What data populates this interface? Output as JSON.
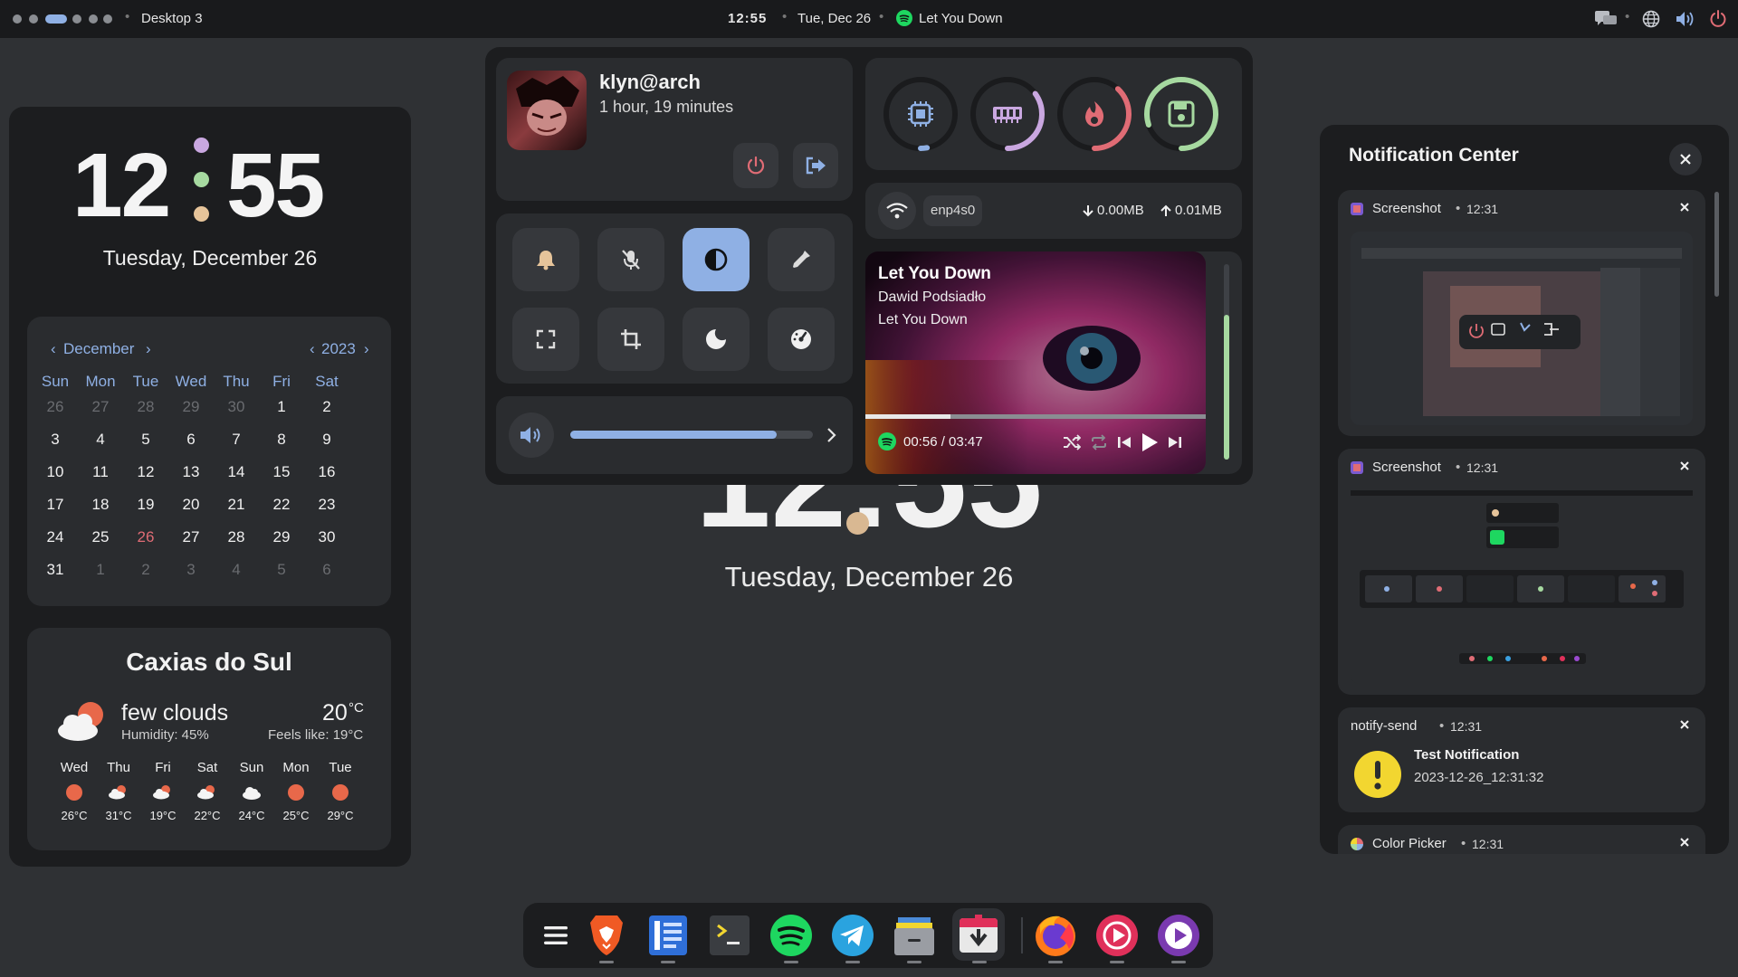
{
  "topbar": {
    "workspace": "Desktop 3",
    "time": "12:55",
    "date": "Tue, Dec 26",
    "now_playing": "Let You Down"
  },
  "background": {
    "time": "12:55",
    "date": "Tuesday, December 26"
  },
  "clock_widget": {
    "hours": "12",
    "minutes": "55",
    "date": "Tuesday, December 26",
    "dot_colors": [
      "#c9a7e0",
      "#a6d9a0",
      "#e6c49a"
    ]
  },
  "calendar": {
    "month": "December",
    "year": "2023",
    "weekdays": [
      "Sun",
      "Mon",
      "Tue",
      "Wed",
      "Thu",
      "Fri",
      "Sat"
    ],
    "weeks": [
      [
        "26",
        "27",
        "28",
        "29",
        "30",
        "1",
        "2"
      ],
      [
        "3",
        "4",
        "5",
        "6",
        "7",
        "8",
        "9"
      ],
      [
        "10",
        "11",
        "12",
        "13",
        "14",
        "15",
        "16"
      ],
      [
        "17",
        "18",
        "19",
        "20",
        "21",
        "22",
        "23"
      ],
      [
        "24",
        "25",
        "26",
        "27",
        "28",
        "29",
        "30"
      ],
      [
        "31",
        "1",
        "2",
        "3",
        "4",
        "5",
        "6"
      ]
    ],
    "today": "26"
  },
  "weather": {
    "city": "Caxias do Sul",
    "condition": "few clouds",
    "humidity": "Humidity: 45%",
    "temp": "20",
    "temp_unit": "°C",
    "feels_like": "Feels like: 19°C",
    "forecast": [
      {
        "day": "Wed",
        "icon": "sun-icon",
        "temp": "26°C"
      },
      {
        "day": "Thu",
        "icon": "cloud-sun-icon",
        "temp": "31°C"
      },
      {
        "day": "Fri",
        "icon": "cloud-sun-icon",
        "temp": "19°C"
      },
      {
        "day": "Sat",
        "icon": "cloud-sun-icon",
        "temp": "22°C"
      },
      {
        "day": "Sun",
        "icon": "cloud-icon",
        "temp": "24°C"
      },
      {
        "day": "Mon",
        "icon": "sun-icon",
        "temp": "25°C"
      },
      {
        "day": "Tue",
        "icon": "sun-icon",
        "temp": "29°C"
      }
    ]
  },
  "user": {
    "name": "klyn@arch",
    "uptime": "1 hour, 19 minutes"
  },
  "system_monitor": [
    {
      "name": "cpu",
      "icon": "cpu-icon",
      "level": 0.03,
      "color": "#8fb0e4"
    },
    {
      "name": "ram",
      "icon": "ram-icon",
      "level": 0.35,
      "color": "#c9a7e0"
    },
    {
      "name": "temperature",
      "icon": "flame-icon",
      "level": 0.38,
      "color": "#e06c75"
    },
    {
      "name": "disk",
      "icon": "disk-icon",
      "level": 0.8,
      "color": "#a6d9a0"
    }
  ],
  "network": {
    "interface": "enp4s0",
    "download": "0.00MB",
    "upload": "0.01MB"
  },
  "media": {
    "title": "Let You Down",
    "artist": "Dawid Podsiadło",
    "album": "Let You Down",
    "position": "00:56 / 03:47",
    "progress": 0.25
  },
  "volume": {
    "level": 0.85
  },
  "notifications": {
    "title": "Notification Center",
    "items": [
      {
        "app": "Screenshot",
        "time": "12:31"
      },
      {
        "app": "Screenshot",
        "time": "12:31"
      },
      {
        "app": "notify-send",
        "time": "12:31",
        "summary": "Test Notification",
        "body": "2023-12-26_12:31:32"
      },
      {
        "app": "Color Picker",
        "time": "12:31"
      }
    ]
  },
  "dock": {
    "apps": [
      "menu-icon",
      "brave-icon",
      "text-editor-icon",
      "terminal-icon",
      "spotify-icon",
      "telegram-icon",
      "files-icon",
      "software-center-icon",
      "firefox-icon",
      "music-player-icon",
      "video-player-icon"
    ]
  }
}
